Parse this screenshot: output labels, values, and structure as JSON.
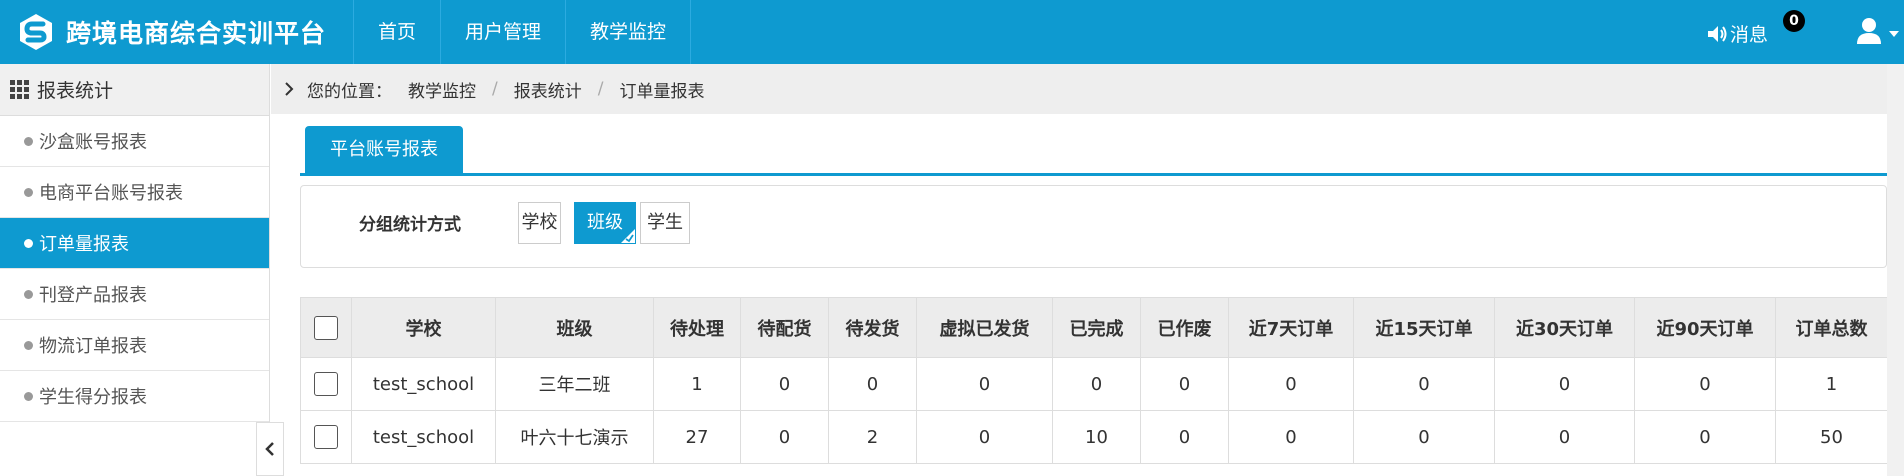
{
  "header": {
    "logo_text": "跨境电商综合实训平台",
    "nav": [
      "首页",
      "用户管理",
      "教学监控"
    ],
    "messages_label": "消息",
    "messages_count": "0",
    "icons": {
      "logo": "logo-s-icon",
      "messages": "speaker-icon",
      "user": "user-icon"
    }
  },
  "sidebar": {
    "title": "报表统计",
    "items": [
      {
        "label": "沙盒账号报表",
        "active": false
      },
      {
        "label": "电商平台账号报表",
        "active": false
      },
      {
        "label": "订单量报表",
        "active": true
      },
      {
        "label": "刊登产品报表",
        "active": false
      },
      {
        "label": "物流订单报表",
        "active": false
      },
      {
        "label": "学生得分报表",
        "active": false
      }
    ]
  },
  "breadcrumb": {
    "prefix": "您的位置：",
    "items": [
      "教学监控",
      "报表统计",
      "订单量报表"
    ],
    "separator": "/"
  },
  "tabs": [
    "平台账号报表"
  ],
  "grouping": {
    "label": "分组统计方式",
    "options": [
      "学校",
      "班级",
      "学生"
    ],
    "selected": "班级"
  },
  "table": {
    "columns": [
      "学校",
      "班级",
      "待处理",
      "待配货",
      "待发货",
      "虚拟已发货",
      "已完成",
      "已作废",
      "近7天订单",
      "近15天订单",
      "近30天订单",
      "近90天订单",
      "订单总数"
    ],
    "rows": [
      [
        "test_school",
        "三年二班",
        "1",
        "0",
        "0",
        "0",
        "0",
        "0",
        "0",
        "0",
        "0",
        "0",
        "1"
      ],
      [
        "test_school",
        "叶六十七演示",
        "27",
        "0",
        "2",
        "0",
        "10",
        "0",
        "0",
        "0",
        "0",
        "0",
        "50"
      ]
    ]
  },
  "colors": {
    "primary": "#0e9ad0",
    "header_bg": "#0e9ad0",
    "table_header_bg": "#ececec"
  }
}
